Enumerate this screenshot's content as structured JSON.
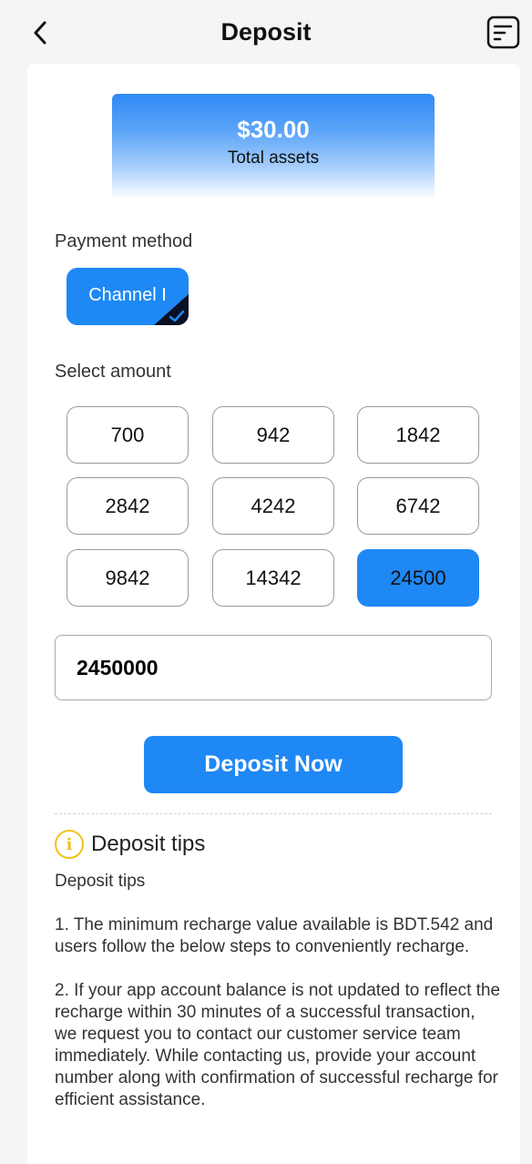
{
  "header": {
    "title": "Deposit"
  },
  "assets": {
    "amount": "$30.00",
    "label": "Total assets"
  },
  "payment": {
    "label": "Payment method",
    "channel": "Channel I"
  },
  "amount_section": {
    "label": "Select amount",
    "options": [
      "700",
      "942",
      "1842",
      "2842",
      "4242",
      "6742",
      "9842",
      "14342",
      "24500"
    ],
    "selected": "24500"
  },
  "input": {
    "value": "2450000"
  },
  "deposit_button": "Deposit Now",
  "tips": {
    "title": "Deposit tips",
    "subtitle": "Deposit tips",
    "items": [
      "1. The minimum recharge value available is BDT.542 and users follow the below steps to conveniently recharge.",
      "2. If your app account balance is not updated to reflect the recharge within 30 minutes of a successful transaction, we request you to contact our customer service team immediately. While contacting us, provide your account number along with confirmation of successful recharge for efficient assistance."
    ]
  },
  "colors": {
    "accent": "#1e88f5",
    "info": "#f2c21b"
  }
}
